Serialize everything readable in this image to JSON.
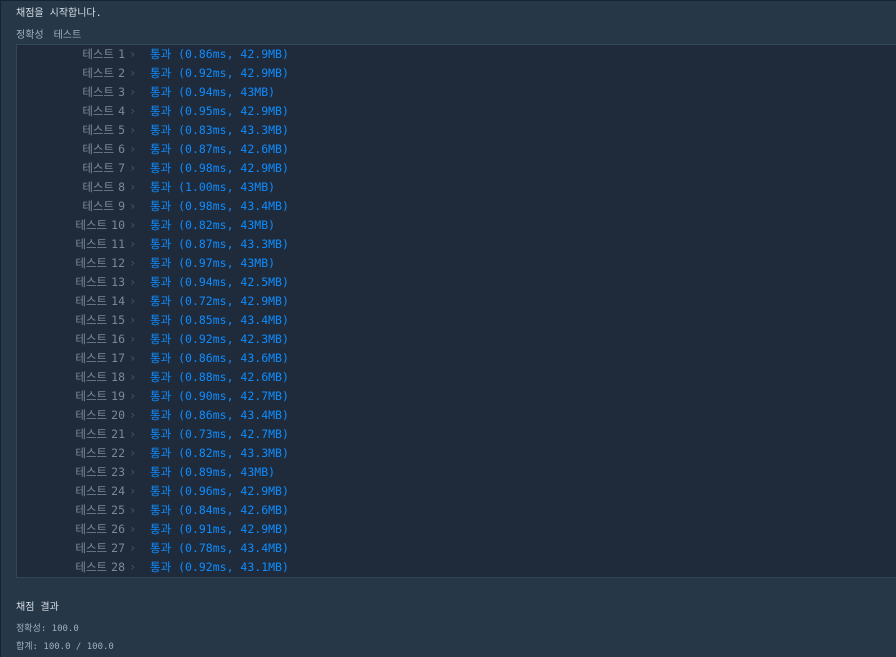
{
  "header": {
    "start_message": "채점을 시작합니다."
  },
  "section": {
    "category": "정확성",
    "subtitle": "테스트"
  },
  "tests": [
    {
      "label": "테스트",
      "num": "1",
      "status": "통과",
      "detail": "(0.86ms, 42.9MB)"
    },
    {
      "label": "테스트",
      "num": "2",
      "status": "통과",
      "detail": "(0.92ms, 42.9MB)"
    },
    {
      "label": "테스트",
      "num": "3",
      "status": "통과",
      "detail": "(0.94ms, 43MB)"
    },
    {
      "label": "테스트",
      "num": "4",
      "status": "통과",
      "detail": "(0.95ms, 42.9MB)"
    },
    {
      "label": "테스트",
      "num": "5",
      "status": "통과",
      "detail": "(0.83ms, 43.3MB)"
    },
    {
      "label": "테스트",
      "num": "6",
      "status": "통과",
      "detail": "(0.87ms, 42.6MB)"
    },
    {
      "label": "테스트",
      "num": "7",
      "status": "통과",
      "detail": "(0.98ms, 42.9MB)"
    },
    {
      "label": "테스트",
      "num": "8",
      "status": "통과",
      "detail": "(1.00ms, 43MB)"
    },
    {
      "label": "테스트",
      "num": "9",
      "status": "통과",
      "detail": "(0.98ms, 43.4MB)"
    },
    {
      "label": "테스트",
      "num": "10",
      "status": "통과",
      "detail": "(0.82ms, 43MB)"
    },
    {
      "label": "테스트",
      "num": "11",
      "status": "통과",
      "detail": "(0.87ms, 43.3MB)"
    },
    {
      "label": "테스트",
      "num": "12",
      "status": "통과",
      "detail": "(0.97ms, 43MB)"
    },
    {
      "label": "테스트",
      "num": "13",
      "status": "통과",
      "detail": "(0.94ms, 42.5MB)"
    },
    {
      "label": "테스트",
      "num": "14",
      "status": "통과",
      "detail": "(0.72ms, 42.9MB)"
    },
    {
      "label": "테스트",
      "num": "15",
      "status": "통과",
      "detail": "(0.85ms, 43.4MB)"
    },
    {
      "label": "테스트",
      "num": "16",
      "status": "통과",
      "detail": "(0.92ms, 42.3MB)"
    },
    {
      "label": "테스트",
      "num": "17",
      "status": "통과",
      "detail": "(0.86ms, 43.6MB)"
    },
    {
      "label": "테스트",
      "num": "18",
      "status": "통과",
      "detail": "(0.88ms, 42.6MB)"
    },
    {
      "label": "테스트",
      "num": "19",
      "status": "통과",
      "detail": "(0.90ms, 42.7MB)"
    },
    {
      "label": "테스트",
      "num": "20",
      "status": "통과",
      "detail": "(0.86ms, 43.4MB)"
    },
    {
      "label": "테스트",
      "num": "21",
      "status": "통과",
      "detail": "(0.73ms, 42.7MB)"
    },
    {
      "label": "테스트",
      "num": "22",
      "status": "통과",
      "detail": "(0.82ms, 43.3MB)"
    },
    {
      "label": "테스트",
      "num": "23",
      "status": "통과",
      "detail": "(0.89ms, 43MB)"
    },
    {
      "label": "테스트",
      "num": "24",
      "status": "통과",
      "detail": "(0.96ms, 42.9MB)"
    },
    {
      "label": "테스트",
      "num": "25",
      "status": "통과",
      "detail": "(0.84ms, 42.6MB)"
    },
    {
      "label": "테스트",
      "num": "26",
      "status": "통과",
      "detail": "(0.91ms, 42.9MB)"
    },
    {
      "label": "테스트",
      "num": "27",
      "status": "통과",
      "detail": "(0.78ms, 43.4MB)"
    },
    {
      "label": "테스트",
      "num": "28",
      "status": "통과",
      "detail": "(0.92ms, 43.1MB)"
    }
  ],
  "chevron_icon": "chevron-right-icon",
  "colors": {
    "background": "#263747",
    "results_box": "#1f2b3a",
    "pass_blue": "#0e8cff",
    "label_gray": "#7a8898"
  },
  "result": {
    "title": "채점 결과",
    "accuracy": "정확성: 100.0",
    "total": "합계: 100.0 / 100.0"
  }
}
